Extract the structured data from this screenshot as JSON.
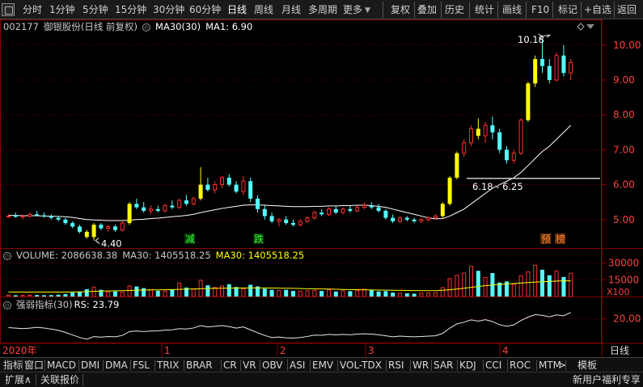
{
  "toolbar": {
    "periods": [
      "分时",
      "1分钟",
      "5分钟",
      "15分钟",
      "30分钟",
      "60分钟",
      "日线",
      "周线",
      "月线",
      "多周期",
      "更多"
    ],
    "active_period": "日线",
    "dropdown_glyph": "▼",
    "actions": [
      "复权",
      "叠加",
      "历史",
      "统计",
      "画线",
      "F10",
      "标记",
      "+自选",
      "返回"
    ]
  },
  "stock": {
    "code": "002177",
    "name": "御银股份",
    "mode": "(日线 前复权)",
    "ma_label": "MA30(30)",
    "ma1_label": "MA1: 6.90"
  },
  "price_axis": {
    "ticks": [
      "10.00",
      "9.00",
      "8.00",
      "7.00",
      "6.00",
      "5.00"
    ],
    "tick_values": [
      10,
      9,
      8,
      7,
      6,
      5
    ],
    "min": 4.3,
    "max": 10.55
  },
  "annotations": {
    "high_label": "10.18",
    "low_label": "4.40",
    "range_label": "6.18 - 6.25",
    "tag_reduce": "减",
    "tag_fall": "跌",
    "tag_forecast": "预",
    "tag_board": "榜"
  },
  "volume": {
    "label": "VOLUME: 2086638.38",
    "ma_label": "MA30: 1405518.25",
    "ma_label_2": "MA30: 1405518.25",
    "ticks": [
      "30000",
      "15000"
    ],
    "tick_values": [
      30000,
      15000
    ],
    "unit": "X100",
    "max": 34000
  },
  "rsi": {
    "label": "强弱指标(30)",
    "value_label": "RS: 23.79",
    "tick": "20.00",
    "tick_value": 20
  },
  "time_axis": {
    "year_label": "2020年",
    "month_labels": [
      "1",
      "2",
      "3",
      "4"
    ],
    "period_label": "日线"
  },
  "tabs": [
    "指标",
    "窗口",
    "MACD",
    "DMI",
    "DMA",
    "FSL",
    "TRIX",
    "BRAR",
    "CR",
    "VR",
    "OBV",
    "ASI",
    "EMV",
    "VOL-TDX",
    "RSI",
    "WR",
    "SAR",
    "KDJ",
    "CCI",
    "ROC",
    "MTM"
  ],
  "tabs_more": ">",
  "template_label": "模板",
  "bottom": {
    "expand": "扩展∧",
    "related": "关联报价",
    "promo": "新用户福利专享"
  },
  "colors": {
    "up": "#ff3030",
    "down": "#54ffff",
    "highlight": "#ffff00",
    "ma": "#ffffff",
    "grid": "#7a0000",
    "axis_text": "#ff4040",
    "vol_ma": "#ffff00"
  },
  "chart_data": {
    "type": "candlestick",
    "ohlc": [
      [
        5.1,
        5.15,
        5.05,
        5.1
      ],
      [
        5.12,
        5.2,
        5.05,
        5.08
      ],
      [
        5.08,
        5.15,
        5.0,
        5.1
      ],
      [
        5.1,
        5.2,
        5.05,
        5.15
      ],
      [
        5.15,
        5.25,
        5.1,
        5.12
      ],
      [
        5.12,
        5.2,
        5.05,
        5.1
      ],
      [
        5.1,
        5.15,
        5.0,
        5.05
      ],
      [
        5.05,
        5.1,
        4.95,
        5.0
      ],
      [
        5.0,
        5.05,
        4.85,
        4.9
      ],
      [
        4.9,
        4.95,
        4.75,
        4.8
      ],
      [
        4.8,
        4.85,
        4.6,
        4.65
      ],
      [
        4.65,
        4.7,
        4.45,
        4.5
      ],
      [
        4.5,
        4.9,
        4.4,
        4.85
      ],
      [
        4.85,
        4.9,
        4.7,
        4.75
      ],
      [
        4.75,
        4.85,
        4.65,
        4.8
      ],
      [
        4.8,
        4.85,
        4.65,
        4.7
      ],
      [
        4.7,
        4.95,
        4.65,
        4.9
      ],
      [
        4.9,
        5.5,
        4.85,
        5.45
      ],
      [
        5.45,
        5.6,
        5.3,
        5.35
      ],
      [
        5.35,
        5.5,
        5.2,
        5.25
      ],
      [
        5.25,
        5.4,
        5.15,
        5.3
      ],
      [
        5.3,
        5.4,
        5.2,
        5.25
      ],
      [
        5.25,
        5.45,
        5.2,
        5.4
      ],
      [
        5.4,
        5.55,
        5.3,
        5.35
      ],
      [
        5.35,
        5.6,
        5.3,
        5.55
      ],
      [
        5.55,
        5.7,
        5.4,
        5.45
      ],
      [
        5.45,
        5.65,
        5.4,
        5.6
      ],
      [
        5.6,
        6.5,
        5.55,
        6.0
      ],
      [
        6.0,
        6.2,
        5.8,
        5.85
      ],
      [
        5.85,
        6.1,
        5.75,
        6.0
      ],
      [
        6.0,
        6.25,
        5.9,
        6.2
      ],
      [
        6.2,
        6.3,
        5.95,
        6.0
      ],
      [
        6.0,
        6.1,
        5.75,
        5.8
      ],
      [
        5.8,
        6.25,
        5.7,
        6.1
      ],
      [
        6.1,
        6.2,
        5.5,
        5.6
      ],
      [
        5.6,
        5.7,
        5.2,
        5.3
      ],
      [
        5.3,
        5.4,
        5.0,
        5.1
      ],
      [
        5.1,
        5.2,
        4.9,
        4.95
      ],
      [
        4.95,
        5.05,
        4.8,
        5.0
      ],
      [
        5.0,
        5.1,
        4.85,
        4.9
      ],
      [
        4.9,
        5.0,
        4.8,
        4.85
      ],
      [
        4.85,
        5.0,
        4.8,
        4.95
      ],
      [
        4.95,
        5.1,
        4.9,
        5.05
      ],
      [
        5.05,
        5.25,
        5.0,
        5.2
      ],
      [
        5.2,
        5.3,
        5.1,
        5.15
      ],
      [
        5.15,
        5.35,
        5.1,
        5.3
      ],
      [
        5.3,
        5.4,
        5.15,
        5.2
      ],
      [
        5.2,
        5.35,
        5.15,
        5.3
      ],
      [
        5.3,
        5.4,
        5.2,
        5.25
      ],
      [
        5.25,
        5.4,
        5.2,
        5.35
      ],
      [
        5.35,
        5.5,
        5.3,
        5.4
      ],
      [
        5.4,
        5.5,
        5.3,
        5.35
      ],
      [
        5.35,
        5.45,
        5.2,
        5.25
      ],
      [
        5.25,
        5.3,
        5.0,
        5.05
      ],
      [
        5.05,
        5.15,
        4.9,
        4.95
      ],
      [
        4.95,
        5.1,
        4.9,
        5.05
      ],
      [
        5.05,
        5.1,
        4.95,
        5.0
      ],
      [
        5.0,
        5.05,
        4.9,
        4.95
      ],
      [
        4.95,
        5.05,
        4.9,
        5.0
      ],
      [
        5.0,
        5.1,
        4.95,
        5.05
      ],
      [
        5.05,
        5.15,
        5.0,
        5.1
      ],
      [
        5.1,
        5.5,
        5.05,
        5.45
      ],
      [
        5.45,
        6.25,
        5.4,
        6.2
      ],
      [
        6.2,
        6.95,
        6.15,
        6.9
      ],
      [
        6.9,
        7.3,
        6.8,
        7.2
      ],
      [
        7.2,
        7.7,
        7.1,
        7.6
      ],
      [
        7.6,
        7.9,
        7.3,
        7.4
      ],
      [
        7.4,
        7.8,
        7.2,
        7.7
      ],
      [
        7.7,
        7.95,
        7.3,
        7.5
      ],
      [
        7.5,
        7.6,
        6.9,
        7.0
      ],
      [
        7.0,
        7.1,
        6.6,
        6.7
      ],
      [
        6.7,
        7.0,
        6.6,
        6.9
      ],
      [
        6.9,
        7.9,
        6.85,
        7.85
      ],
      [
        7.85,
        8.95,
        7.8,
        8.9
      ],
      [
        8.9,
        9.7,
        8.8,
        9.6
      ],
      [
        9.6,
        10.18,
        9.2,
        9.4
      ],
      [
        9.4,
        9.6,
        8.9,
        9.0
      ],
      [
        9.0,
        9.8,
        8.95,
        9.7
      ],
      [
        9.7,
        10.0,
        9.1,
        9.2
      ],
      [
        9.2,
        9.6,
        9.0,
        9.5
      ]
    ],
    "highlight_indices": [
      11,
      12,
      17,
      27,
      61,
      62,
      63,
      66,
      73,
      74
    ],
    "ma30": [
      5.12,
      5.12,
      5.11,
      5.11,
      5.11,
      5.1,
      5.1,
      5.09,
      5.08,
      5.06,
      5.03,
      5.0,
      4.99,
      4.98,
      4.97,
      4.97,
      4.97,
      4.98,
      5.0,
      5.01,
      5.03,
      5.04,
      5.06,
      5.08,
      5.1,
      5.12,
      5.15,
      5.2,
      5.24,
      5.28,
      5.32,
      5.35,
      5.38,
      5.41,
      5.42,
      5.42,
      5.41,
      5.4,
      5.39,
      5.38,
      5.37,
      5.37,
      5.37,
      5.38,
      5.38,
      5.39,
      5.39,
      5.4,
      5.4,
      5.41,
      5.41,
      5.4,
      5.38,
      5.35,
      5.3,
      5.25,
      5.2,
      5.15,
      5.1,
      5.05,
      5.02,
      5.03,
      5.1,
      5.2,
      5.3,
      5.45,
      5.6,
      5.75,
      5.9,
      6.0,
      6.1,
      6.2,
      6.35,
      6.55,
      6.75,
      6.95,
      7.1,
      7.3,
      7.5,
      7.7
    ],
    "volume": [
      1200,
      1100,
      1000,
      1150,
      1300,
      1100,
      1250,
      1600,
      2200,
      3500,
      4200,
      6500,
      8500,
      6000,
      4000,
      4500,
      3800,
      9500,
      9000,
      7500,
      6000,
      5200,
      4800,
      6500,
      12000,
      8000,
      6500,
      14500,
      10000,
      8000,
      9500,
      11000,
      8500,
      7000,
      10500,
      9000,
      7000,
      6000,
      5500,
      6000,
      5000,
      4800,
      5200,
      5500,
      5000,
      6000,
      4500,
      5200,
      4800,
      5500,
      6500,
      6000,
      4500,
      4800,
      3500,
      3000,
      2800,
      2500,
      3000,
      3200,
      3500,
      8000,
      16000,
      19000,
      21000,
      27000,
      23000,
      17000,
      21000,
      12500,
      13500,
      11000,
      18500,
      22000,
      28000,
      24000,
      19000,
      23000,
      17500,
      20866
    ],
    "vol_ma30": [
      4000,
      4000,
      4000,
      4000,
      4000,
      4000,
      4000,
      4000,
      4000,
      4100,
      4200,
      4400,
      4600,
      4800,
      5000,
      5100,
      5200,
      5400,
      5600,
      5800,
      5900,
      6000,
      6100,
      6200,
      6400,
      6600,
      6800,
      7000,
      7200,
      7300,
      7400,
      7500,
      7600,
      7600,
      7700,
      7700,
      7700,
      7600,
      7500,
      7400,
      7300,
      7100,
      7000,
      6900,
      6800,
      6700,
      6500,
      6300,
      6200,
      6100,
      6000,
      5900,
      5800,
      5700,
      5600,
      5500,
      5400,
      5300,
      5200,
      5200,
      5300,
      5600,
      6100,
      6700,
      7400,
      8200,
      9000,
      9700,
      10300,
      10800,
      11300,
      11700,
      12100,
      12500,
      12900,
      13200,
      13500,
      13800,
      14000,
      14055
    ],
    "rsi": [
      14.8,
      14.5,
      14.2,
      14.5,
      15.0,
      14.6,
      14.0,
      13.2,
      12.0,
      10.5,
      9.0,
      8.0,
      9.5,
      9.2,
      9.6,
      9.4,
      10.2,
      12.5,
      12.8,
      12.5,
      12.8,
      12.9,
      13.3,
      13.5,
      14.2,
      14.0,
      14.6,
      16.0,
      15.2,
      15.6,
      16.0,
      15.4,
      14.5,
      15.2,
      13.5,
      11.8,
      10.2,
      9.0,
      9.3,
      8.8,
      8.6,
      9.0,
      9.6,
      10.4,
      10.3,
      10.8,
      10.5,
      10.8,
      10.6,
      11.0,
      11.2,
      11.0,
      10.6,
      10.0,
      9.4,
      9.8,
      9.6,
      9.4,
      9.6,
      9.8,
      10.0,
      11.4,
      14.5,
      17.0,
      18.0,
      19.4,
      18.6,
      19.5,
      18.4,
      16.5,
      15.6,
      16.4,
      19.0,
      21.0,
      22.5,
      22.0,
      21.2,
      22.3,
      21.8,
      23.79
    ],
    "rsi_max": 26,
    "rsi_min": 6
  }
}
